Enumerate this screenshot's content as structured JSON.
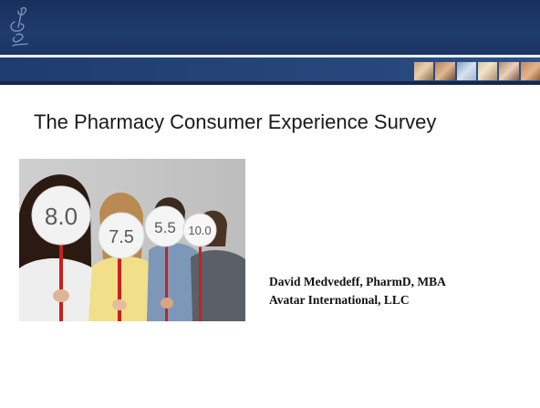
{
  "slide": {
    "title": "The Pharmacy Consumer Experience Survey",
    "author": {
      "name_line": "David Medvedeff, PharmD, MBA",
      "org_line": "Avatar International, LLC"
    }
  },
  "photo": {
    "description_icon": "survey-scorecards-photo",
    "score_cards": [
      "8.0",
      "7.5",
      "5.5",
      "10.0"
    ]
  },
  "colors": {
    "header_navy": "#1f3c6e",
    "header_dark": "#17305c",
    "separator": "#e9edf4",
    "title_text": "#1a1a1a"
  }
}
